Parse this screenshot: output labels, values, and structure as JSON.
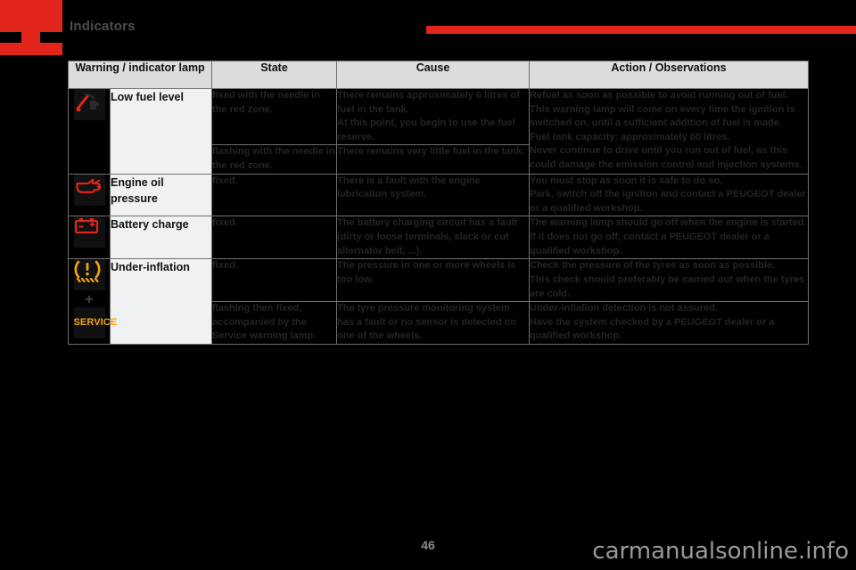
{
  "header": {
    "chapter_title": "Indicators",
    "brand_color": "#e1251b",
    "rule_color": "#e1251b"
  },
  "table": {
    "columns": [
      {
        "key": "lamp",
        "label": "Warning / indicator lamp"
      },
      {
        "key": "state",
        "label": "State"
      },
      {
        "key": "cause",
        "label": "Cause"
      },
      {
        "key": "action",
        "label": "Action / Observations"
      }
    ],
    "rows": [
      {
        "icon": "fuel-gauge-icon",
        "icon_color": "#e1251b",
        "name": "Low fuel level",
        "sub": [
          {
            "state": "fixed with the needle in the red zone.",
            "cause": "There remains approximately 6 litres of fuel in the tank.\nAt this point, you begin to use the fuel reserve.",
            "action": "Refuel as soon as possible to avoid running out of fuel.\nThis warning lamp will come on every time the ignition is switched on, until a sufficient addition of fuel is made.\nFuel tank capacity: approximately 60 litres.\nNever continue to drive until you run out of fuel, as this could damage the emission control and injection systems."
          },
          {
            "state": "flashing with the needle in the red zone.",
            "cause": "There remains very little fuel in the tank.",
            "action": ""
          }
        ]
      },
      {
        "icon": "oil-can-icon",
        "icon_color": "#e1251b",
        "name": "Engine oil pressure",
        "sub": [
          {
            "state": "fixed.",
            "cause": "There is a fault with the engine lubrication system.",
            "action": "You must stop as soon it is safe to do so.\nPark, switch off the ignition and contact a PEUGEOT dealer or a qualified workshop."
          }
        ]
      },
      {
        "icon": "battery-icon",
        "icon_color": "#e1251b",
        "name": "Battery charge",
        "sub": [
          {
            "state": "fixed.",
            "cause": "The battery charging circuit has a fault (dirty or loose terminals, slack or cut alternator belt, ...).",
            "action": "The warning lamp should go off when the engine is started.\nIf it does not go off, contact a PEUGEOT dealer or a qualified workshop."
          }
        ]
      },
      {
        "icon": "tyre-pressure-icon",
        "icon_color": "#f5a30f",
        "name": "Under-inflation",
        "sub": [
          {
            "state": "fixed.",
            "cause": "The pressure in one or more wheels is too low.",
            "action": "Check the pressure of the tyres as soon as possible.\nThis check should preferably be carried out when the tyres are cold."
          },
          {
            "state": "flashing then fixed, accompanied by the Service warning lamp.",
            "cause": "The tyre pressure monitoring system has a fault or no sensor is detected on one of the wheels.",
            "action": "Under-inflation detection is not assured.\nHave the system checked by a PEUGEOT dealer or a qualified workshop."
          }
        ]
      }
    ],
    "service_badge_label": "SERVICE",
    "service_badge_color": "#f5a30f"
  },
  "footer": {
    "page_number": "46",
    "watermark": "carmanualsonline.info"
  }
}
